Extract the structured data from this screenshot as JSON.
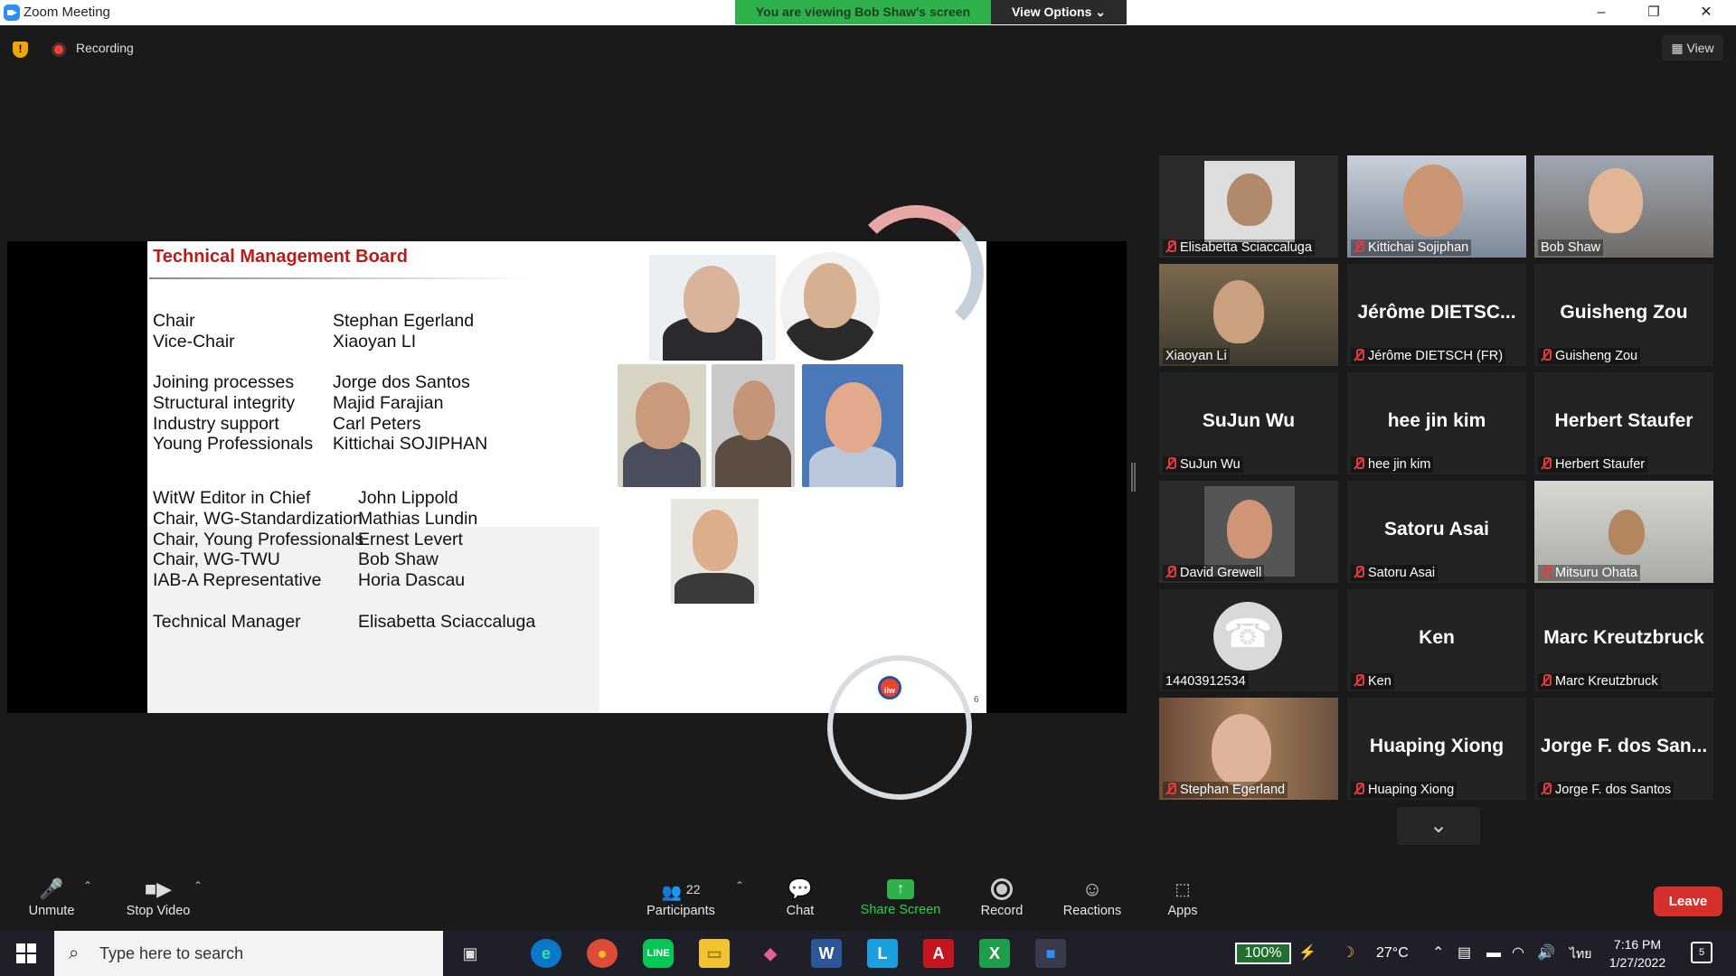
{
  "window": {
    "title": "Zoom Meeting",
    "viewing_banner": "You are viewing Bob Shaw's screen",
    "view_options": "View Options ⌄",
    "min": "–",
    "max": "❐",
    "close": "✕"
  },
  "top": {
    "recording_label": "Recording",
    "view_label": "▦ View"
  },
  "slide": {
    "title": "Technical Management Board",
    "page_number": "6",
    "logo_text": "iiw",
    "roles": [
      {
        "role": "Chair",
        "name": "Stephan Egerland"
      },
      {
        "role": "Vice-Chair",
        "name": "Xiaoyan LI"
      },
      {
        "role": "Joining processes",
        "name": "Jorge dos Santos"
      },
      {
        "role": "Structural integrity",
        "name": "Majid Farajian"
      },
      {
        "role": "Industry support",
        "name": "Carl Peters"
      },
      {
        "role": "Young Professionals",
        "name": "Kittichai SOJIPHAN"
      },
      {
        "role": "WitW Editor in Chief",
        "name": "John Lippold"
      },
      {
        "role": "Chair, WG-Standardization",
        "name": "Mathias Lundin"
      },
      {
        "role": "Chair, Young Professionals",
        "name": "Ernest Levert"
      },
      {
        "role": "Chair, WG-TWU",
        "name": "Bob Shaw"
      },
      {
        "role": "IAB-A Representative",
        "name": "Horia Dascau"
      },
      {
        "role": "Technical Manager",
        "name": "Elisabetta Sciaccaluga"
      }
    ]
  },
  "gallery": {
    "tiles": [
      {
        "label": "Elisabetta Sciaccaluga",
        "big": "",
        "muted": true
      },
      {
        "label": "Kittichai Sojiphan",
        "big": "",
        "muted": true
      },
      {
        "label": "Bob Shaw",
        "big": "",
        "muted": false
      },
      {
        "label": "Xiaoyan Li",
        "big": "",
        "muted": false
      },
      {
        "label": "Jérôme DIETSCH (FR)",
        "big": "Jérôme DIETSC...",
        "muted": true
      },
      {
        "label": "Guisheng Zou",
        "big": "Guisheng Zou",
        "muted": true
      },
      {
        "label": "SuJun Wu",
        "big": "SuJun Wu",
        "muted": true
      },
      {
        "label": "hee jin kim",
        "big": "hee jin kim",
        "muted": true
      },
      {
        "label": "Herbert Staufer",
        "big": "Herbert Staufer",
        "muted": true
      },
      {
        "label": "David Grewell",
        "big": "",
        "muted": true
      },
      {
        "label": "Satoru Asai",
        "big": "Satoru Asai",
        "muted": true
      },
      {
        "label": "Mitsuru Ohata",
        "big": "",
        "muted": true
      },
      {
        "label": "14403912534",
        "big": "",
        "muted": false
      },
      {
        "label": "Ken",
        "big": "Ken",
        "muted": true
      },
      {
        "label": "Marc Kreutzbruck",
        "big": "Marc Kreutzbruck",
        "muted": true
      },
      {
        "label": "Stephan Egerland",
        "big": "",
        "muted": true
      },
      {
        "label": "Huaping Xiong",
        "big": "Huaping Xiong",
        "muted": true
      },
      {
        "label": "Jorge F. dos Santos",
        "big": "Jorge F. dos San...",
        "muted": true
      }
    ],
    "active_speaker": "Xiaoyan Li",
    "next_page": "⌄"
  },
  "toolbar": {
    "unmute": "Unmute",
    "stop_video": "Stop Video",
    "participants": "Participants",
    "participants_count": "22",
    "chat": "Chat",
    "share_screen": "Share Screen",
    "record": "Record",
    "reactions": "Reactions",
    "apps": "Apps",
    "leave": "Leave"
  },
  "taskbar": {
    "search_placeholder": "Type here to search",
    "battery": "100%",
    "temperature": "27°C",
    "language": "ไทย",
    "time": "7:16 PM",
    "date": "1/27/2022",
    "notifications": "5"
  },
  "colors": {
    "banner_green": "#2fb24c",
    "leave_red": "#d6302b",
    "active_speaker_border": "#f2ee45",
    "slide_title_red": "#b81c1c",
    "mute_red": "#e23b3b"
  }
}
